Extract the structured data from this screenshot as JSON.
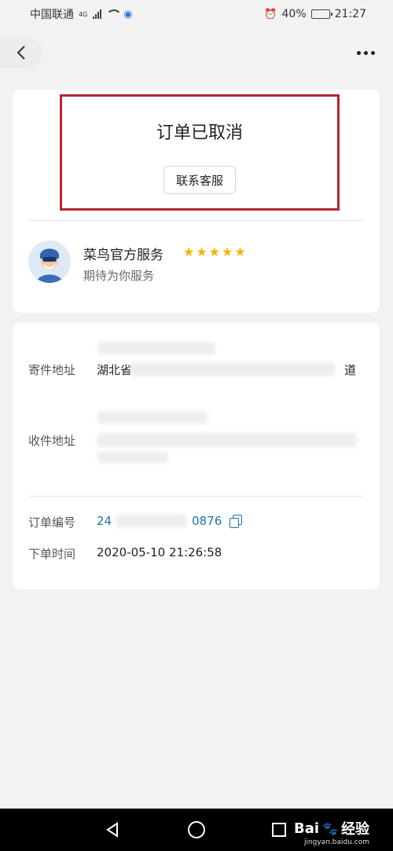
{
  "status_bar": {
    "carrier": "中国联通",
    "network": "4G",
    "battery": "40%",
    "battery_level": 0.4,
    "time": "21:27"
  },
  "top_bar": {
    "back_icon": "chevron-left-icon",
    "more_icon": "more-dots-icon"
  },
  "order_status": {
    "title": "订单已取消",
    "contact_button": "联系客服"
  },
  "courier": {
    "name": "菜鸟官方服务",
    "subtitle": "期待为你服务",
    "rating": 5,
    "rating_max": 5,
    "star_color": "#f5b400"
  },
  "addresses": {
    "sender_label": "寄件地址",
    "sender_text_visible": "湖北省",
    "sender_text_end": "道",
    "receiver_label": "收件地址"
  },
  "order": {
    "number_label": "订单编号",
    "number_visible_start": "24",
    "number_visible_end": "0876",
    "time_label": "下单时间",
    "time_value": "2020-05-10 21:26:58"
  },
  "colors": {
    "highlight_border": "#b3262e",
    "link": "#1e6fb8",
    "background": "#f2f2f2"
  },
  "watermark": {
    "brand": "Bai",
    "suffix": "经验",
    "url": "jingyan.baidu.com"
  }
}
